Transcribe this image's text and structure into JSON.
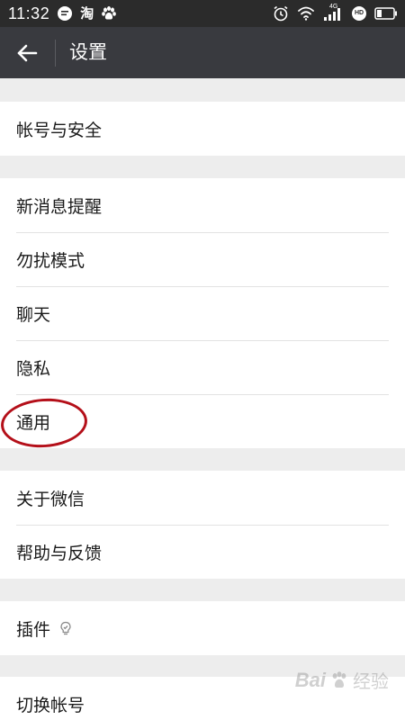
{
  "status_bar": {
    "time": "11:32",
    "taobao_glyph": "淘",
    "network": "4G",
    "hd_badge": "HD"
  },
  "header": {
    "title": "设置"
  },
  "groups": [
    {
      "items": [
        {
          "label": "帐号与安全"
        }
      ]
    },
    {
      "items": [
        {
          "label": "新消息提醒"
        },
        {
          "label": "勿扰模式"
        },
        {
          "label": "聊天"
        },
        {
          "label": "隐私"
        },
        {
          "label": "通用"
        }
      ]
    },
    {
      "items": [
        {
          "label": "关于微信"
        },
        {
          "label": "帮助与反馈"
        }
      ]
    },
    {
      "items": [
        {
          "label": "插件"
        }
      ]
    },
    {
      "items": [
        {
          "label": "切换帐号"
        }
      ]
    }
  ],
  "watermark": {
    "text": "Bai",
    "suffix": "经验"
  },
  "colors": {
    "header_bg": "#393a3f",
    "status_bar_bg": "#2b2b2b",
    "page_bg": "#ededed",
    "highlight": "#b40f19"
  }
}
